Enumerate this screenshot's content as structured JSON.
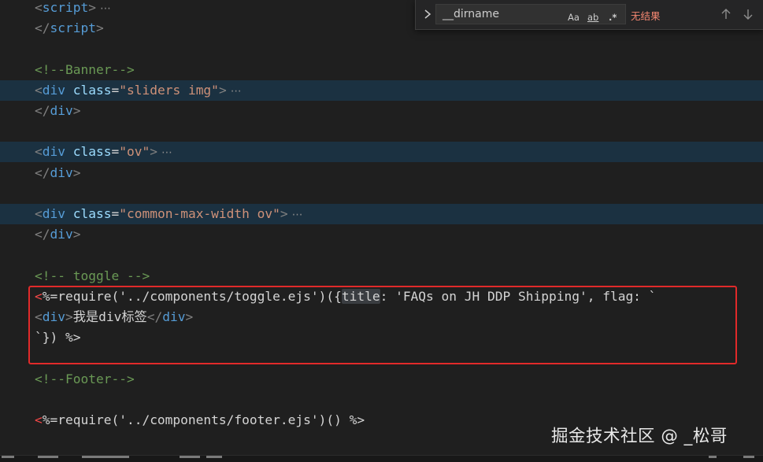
{
  "find_widget": {
    "query": "__dirname",
    "match_case_label": "Aa",
    "whole_word_label": "ab",
    "regex_label": ".*",
    "no_results": "无结果"
  },
  "code_lines": [
    {
      "tokens": [
        {
          "cls": "br",
          "text": "<"
        },
        {
          "cls": "tag",
          "text": "script"
        },
        {
          "cls": "br",
          "text": ">"
        }
      ],
      "folded": true
    },
    {
      "tokens": [
        {
          "cls": "br",
          "text": "</"
        },
        {
          "cls": "tag",
          "text": "script"
        },
        {
          "cls": "br",
          "text": ">"
        }
      ]
    },
    {
      "tokens": []
    },
    {
      "tokens": [
        {
          "cls": "cmt",
          "text": "<!--Banner-->"
        }
      ]
    },
    {
      "tokens": [
        {
          "cls": "br",
          "text": "<"
        },
        {
          "cls": "tag",
          "text": "div"
        },
        {
          "cls": "txt",
          "text": " "
        },
        {
          "cls": "attr",
          "text": "class"
        },
        {
          "cls": "txt",
          "text": "="
        },
        {
          "cls": "str",
          "text": "\"sliders img\""
        },
        {
          "cls": "br",
          "text": ">"
        }
      ],
      "folded": true,
      "highlight": true
    },
    {
      "tokens": [
        {
          "cls": "br",
          "text": "</"
        },
        {
          "cls": "tag",
          "text": "div"
        },
        {
          "cls": "br",
          "text": ">"
        }
      ]
    },
    {
      "tokens": []
    },
    {
      "tokens": [
        {
          "cls": "br",
          "text": "<"
        },
        {
          "cls": "tag",
          "text": "div"
        },
        {
          "cls": "txt",
          "text": " "
        },
        {
          "cls": "attr",
          "text": "class"
        },
        {
          "cls": "txt",
          "text": "="
        },
        {
          "cls": "str",
          "text": "\"ov\""
        },
        {
          "cls": "br",
          "text": ">"
        }
      ],
      "folded": true,
      "highlight": true
    },
    {
      "tokens": [
        {
          "cls": "br",
          "text": "</"
        },
        {
          "cls": "tag",
          "text": "div"
        },
        {
          "cls": "br",
          "text": ">"
        }
      ]
    },
    {
      "tokens": []
    },
    {
      "tokens": [
        {
          "cls": "br",
          "text": "<"
        },
        {
          "cls": "tag",
          "text": "div"
        },
        {
          "cls": "txt",
          "text": " "
        },
        {
          "cls": "attr",
          "text": "class"
        },
        {
          "cls": "txt",
          "text": "="
        },
        {
          "cls": "str",
          "text": "\"common-max-width ov\""
        },
        {
          "cls": "br",
          "text": ">"
        }
      ],
      "folded": true,
      "highlight": true
    },
    {
      "tokens": [
        {
          "cls": "br",
          "text": "</"
        },
        {
          "cls": "tag",
          "text": "div"
        },
        {
          "cls": "br",
          "text": ">"
        }
      ]
    },
    {
      "tokens": []
    },
    {
      "tokens": [
        {
          "cls": "cmt",
          "text": "<!-- toggle -->"
        }
      ]
    },
    {
      "tokens": [
        {
          "cls": "ejs",
          "text": "<"
        },
        {
          "cls": "txt",
          "text": "%=require('../components/toggle.ejs')({"
        },
        {
          "cls": "txt match",
          "text": "title"
        },
        {
          "cls": "txt",
          "text": ": 'FAQs on JH DDP Shipping', flag: `"
        }
      ]
    },
    {
      "tokens": [
        {
          "cls": "br",
          "text": "<"
        },
        {
          "cls": "tag",
          "text": "div"
        },
        {
          "cls": "br",
          "text": ">"
        },
        {
          "cls": "txt cjk",
          "text": "我是"
        },
        {
          "cls": "txt",
          "text": "div"
        },
        {
          "cls": "txt cjk",
          "text": "标签"
        },
        {
          "cls": "br",
          "text": "</"
        },
        {
          "cls": "tag",
          "text": "div"
        },
        {
          "cls": "br",
          "text": ">"
        }
      ]
    },
    {
      "tokens": [
        {
          "cls": "txt",
          "text": "`}) %>"
        }
      ]
    },
    {
      "tokens": []
    },
    {
      "tokens": [
        {
          "cls": "cmt",
          "text": "<!--Footer-->"
        }
      ]
    },
    {
      "tokens": []
    },
    {
      "tokens": [
        {
          "cls": "ejs",
          "text": "<"
        },
        {
          "cls": "txt",
          "text": "%=require('../components/footer.ejs')() %>"
        }
      ]
    }
  ],
  "fold_marker": "⋯",
  "watermark": "掘金技术社区 @ _松哥",
  "colors": {
    "background": "#1f1f1f",
    "highlight_line": "#1b3141",
    "annotation_box": "#e12a2a",
    "no_results": "#f48771"
  }
}
